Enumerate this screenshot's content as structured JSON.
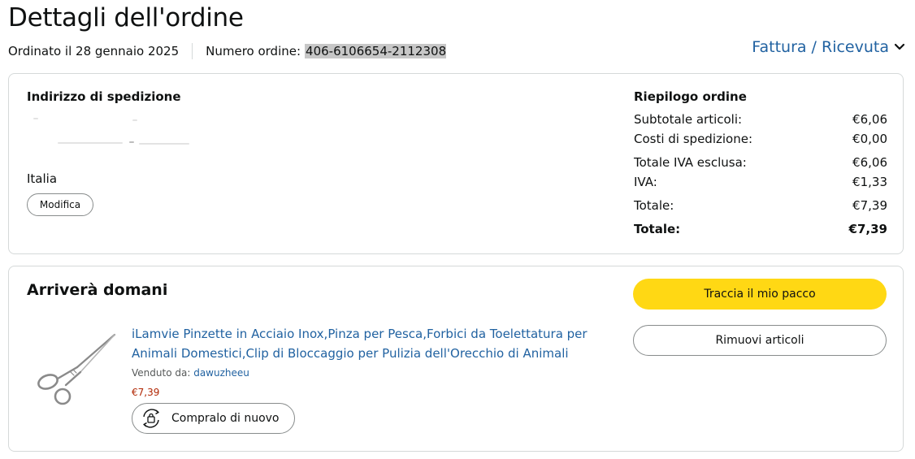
{
  "header": {
    "title": "Dettagli dell'ordine",
    "ordered_on": "Ordinato il 28 gennaio 2025",
    "order_number_label": "Numero ordine:",
    "order_number": "406-6106654-2112308",
    "invoice_label": "Fattura / Ricevuta",
    "invoice_icon": "chevron-down-icon"
  },
  "address": {
    "heading": "Indirizzo di spedizione",
    "country": "Italia",
    "edit_label": "Modifica"
  },
  "summary": {
    "heading": "Riepilogo ordine",
    "rows": [
      {
        "label": "Subtotale articoli:",
        "value": "€6,06"
      },
      {
        "label": "Costi di spedizione:",
        "value": "€0,00"
      },
      {
        "label": "Totale IVA esclusa:",
        "value": "€6,06"
      },
      {
        "label": "IVA:",
        "value": "€1,33"
      },
      {
        "label": "Totale:",
        "value": "€7,39"
      },
      {
        "label": "Totale:",
        "value": "€7,39"
      }
    ]
  },
  "shipment": {
    "heading": "Arriverà domani",
    "track_label": "Traccia il mio pacco",
    "remove_label": "Rimuovi articoli",
    "item": {
      "title": "iLamvie Pinzette in Acciaio Inox,Pinza per Pesca,Forbici da Toelettatura per Animali Domestici,Clip di Bloccaggio per Pulizia dell'Orecchio di Animali",
      "sold_by_label": "Venduto da:",
      "seller": "dawuzheeu",
      "price": "€7,39",
      "buy_again_label": "Compralo di nuovo",
      "image_icon": "hemostat-forceps-image",
      "buy_again_icon": "buy-again-icon"
    }
  },
  "colors": {
    "link": "#2162a1",
    "primary_button": "#ffd814",
    "price": "#b12704",
    "border": "#d5d9d9"
  }
}
